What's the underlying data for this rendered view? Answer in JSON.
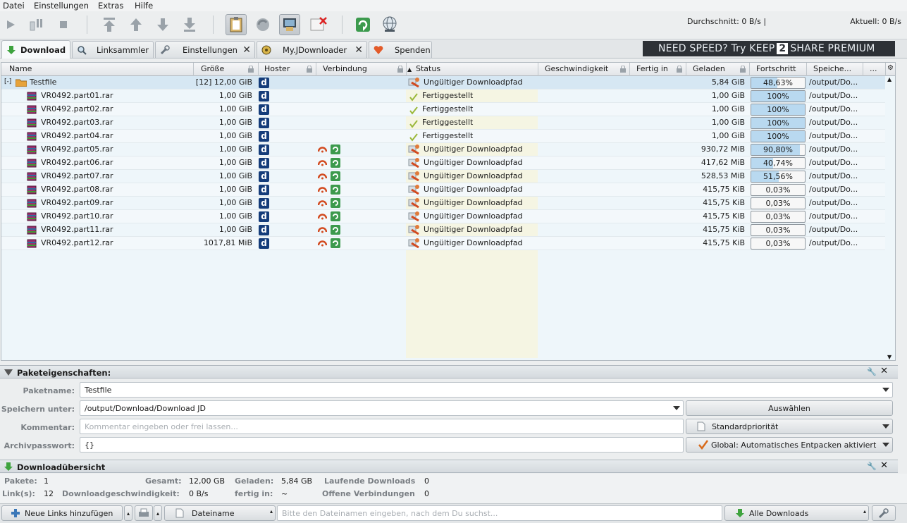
{
  "menu": [
    "Datei",
    "Einstellungen",
    "Extras",
    "Hilfe"
  ],
  "speed": {
    "average": "Durchschnitt: 0 B/s |",
    "current": "Aktuell: 0 B/s"
  },
  "tabs": [
    {
      "label": "Download",
      "icon": "download-arrow-icon"
    },
    {
      "label": "Linksammler",
      "icon": "magnifier-icon"
    },
    {
      "label": "Einstellungen",
      "icon": "wrench-icon"
    },
    {
      "label": "My.JDownloader",
      "icon": "myjd-icon"
    },
    {
      "label": "Spenden",
      "icon": "heart-icon"
    }
  ],
  "banner": {
    "pre": "NEED SPEED? Try KEEP",
    "num": "2",
    "post": "SHARE PREMIUM"
  },
  "columns": [
    "Name",
    "Größe",
    "Hoster",
    "Verbindung",
    "Status",
    "Geschwindigkeit",
    "Fertig in",
    "Geladen",
    "Fortschritt",
    "Speiche...",
    "..."
  ],
  "package": {
    "expander": "[-]",
    "name": "Testfile",
    "size": "[12] 12,00 GiB",
    "hoster": "d",
    "status": "Ungültiger Downloadpfad",
    "loaded": "5,84 GiB",
    "progress": "48,63%",
    "progress_value": 48.63,
    "save": "/output/Do..."
  },
  "files": [
    {
      "name": "VR0492.part01.rar",
      "size": "1,00 GiB",
      "hoster": "d",
      "conn": false,
      "status": "Fertiggestellt",
      "ok": true,
      "loaded": "1,00 GiB",
      "progress": "100%",
      "progress_value": 100,
      "save": "/output/Do..."
    },
    {
      "name": "VR0492.part02.rar",
      "size": "1,00 GiB",
      "hoster": "d",
      "conn": false,
      "status": "Fertiggestellt",
      "ok": true,
      "loaded": "1,00 GiB",
      "progress": "100%",
      "progress_value": 100,
      "save": "/output/Do..."
    },
    {
      "name": "VR0492.part03.rar",
      "size": "1,00 GiB",
      "hoster": "d",
      "conn": false,
      "status": "Fertiggestellt",
      "ok": true,
      "loaded": "1,00 GiB",
      "progress": "100%",
      "progress_value": 100,
      "save": "/output/Do..."
    },
    {
      "name": "VR0492.part04.rar",
      "size": "1,00 GiB",
      "hoster": "d",
      "conn": false,
      "status": "Fertiggestellt",
      "ok": true,
      "loaded": "1,00 GiB",
      "progress": "100%",
      "progress_value": 100,
      "save": "/output/Do..."
    },
    {
      "name": "VR0492.part05.rar",
      "size": "1,00 GiB",
      "hoster": "d",
      "conn": true,
      "status": "Ungültiger Downloadpfad",
      "ok": false,
      "loaded": "930,72 MiB",
      "progress": "90,80%",
      "progress_value": 90.8,
      "save": "/output/Do..."
    },
    {
      "name": "VR0492.part06.rar",
      "size": "1,00 GiB",
      "hoster": "d",
      "conn": true,
      "status": "Ungültiger Downloadpfad",
      "ok": false,
      "loaded": "417,62 MiB",
      "progress": "40,74%",
      "progress_value": 40.74,
      "save": "/output/Do..."
    },
    {
      "name": "VR0492.part07.rar",
      "size": "1,00 GiB",
      "hoster": "d",
      "conn": true,
      "status": "Ungültiger Downloadpfad",
      "ok": false,
      "loaded": "528,53 MiB",
      "progress": "51,56%",
      "progress_value": 51.56,
      "save": "/output/Do..."
    },
    {
      "name": "VR0492.part08.rar",
      "size": "1,00 GiB",
      "hoster": "d",
      "conn": true,
      "status": "Ungültiger Downloadpfad",
      "ok": false,
      "loaded": "415,75 KiB",
      "progress": "0,03%",
      "progress_value": 0.03,
      "save": "/output/Do..."
    },
    {
      "name": "VR0492.part09.rar",
      "size": "1,00 GiB",
      "hoster": "d",
      "conn": true,
      "status": "Ungültiger Downloadpfad",
      "ok": false,
      "loaded": "415,75 KiB",
      "progress": "0,03%",
      "progress_value": 0.03,
      "save": "/output/Do..."
    },
    {
      "name": "VR0492.part10.rar",
      "size": "1,00 GiB",
      "hoster": "d",
      "conn": true,
      "status": "Ungültiger Downloadpfad",
      "ok": false,
      "loaded": "415,75 KiB",
      "progress": "0,03%",
      "progress_value": 0.03,
      "save": "/output/Do..."
    },
    {
      "name": "VR0492.part11.rar",
      "size": "1,00 GiB",
      "hoster": "d",
      "conn": true,
      "status": "Ungültiger Downloadpfad",
      "ok": false,
      "loaded": "415,75 KiB",
      "progress": "0,03%",
      "progress_value": 0.03,
      "save": "/output/Do..."
    },
    {
      "name": "VR0492.part12.rar",
      "size": "1017,81 MiB",
      "hoster": "d",
      "conn": true,
      "status": "Ungültiger Downloadpfad",
      "ok": false,
      "loaded": "415,75 KiB",
      "progress": "0,03%",
      "progress_value": 0.03,
      "save": "/output/Do..."
    }
  ],
  "props": {
    "title": "Paketeigenschaften:",
    "name_label": "Paketname:",
    "name_value": "Testfile",
    "save_label": "Speichern unter:",
    "save_value": "/output/Download/Download JD",
    "choose_button": "Auswählen",
    "comment_label": "Kommentar:",
    "comment_placeholder": "Kommentar eingeben oder frei lassen...",
    "priority": "Standardpriorität",
    "password_label": "Archivpasswort:",
    "password_value": "{}",
    "extract": "Global: Automatisches Entpacken aktiviert"
  },
  "overview": {
    "title": "Downloadübersicht",
    "packages_label": "Pakete:",
    "packages": "1",
    "links_label": "Link(s):",
    "links": "12",
    "total_label": "Gesamt:",
    "total": "12,00 GB",
    "speed_label": "Downloadgeschwindigkeit:",
    "speed": "0 B/s",
    "loaded_label": "Geladen:",
    "loaded": "5,84 GB",
    "eta_label": "fertig in:",
    "eta": "~",
    "running_label": "Laufende Downloads",
    "running": "0",
    "open_label": "Offene Verbindungen",
    "open": "0"
  },
  "bottom": {
    "add_links": "Neue Links hinzufügen",
    "search_field": "Dateiname",
    "search_placeholder": "Bitte den Dateinamen eingeben, nach dem Du suchst...",
    "filter": "Alle Downloads"
  },
  "colors": {
    "accent": "#b9d9f0",
    "status_bg": "#f5f5e3",
    "hoster_bg": "#143c7a"
  }
}
